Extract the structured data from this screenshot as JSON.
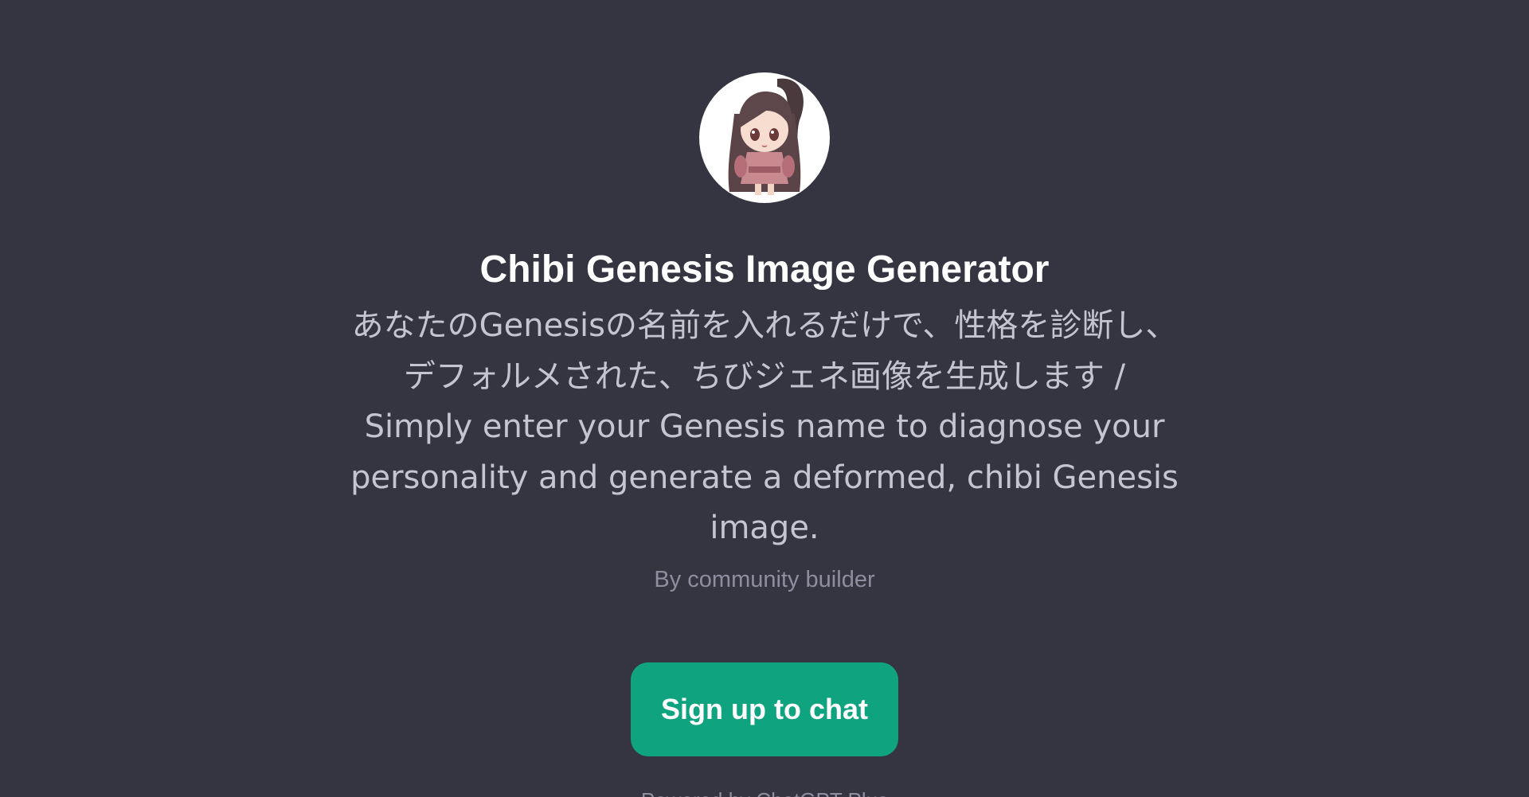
{
  "gpt": {
    "title": "Chibi Genesis Image Generator",
    "description": "あなたのGenesisの名前を入れるだけで、性格を診断し、デフォルメされた、ちびジェネ画像を生成します / Simply enter your Genesis name to diagnose your personality and generate a deformed, chibi Genesis image.",
    "byline": "By community builder",
    "avatar_icon": "chibi-character-avatar"
  },
  "actions": {
    "signup_label": "Sign up to chat"
  },
  "footer": {
    "text": "Powered by ChatGPT Plus"
  },
  "colors": {
    "background": "#343541",
    "accent": "#10a37f",
    "title": "#ffffff",
    "description": "#c5c5d2",
    "muted": "#8e8ea0"
  }
}
